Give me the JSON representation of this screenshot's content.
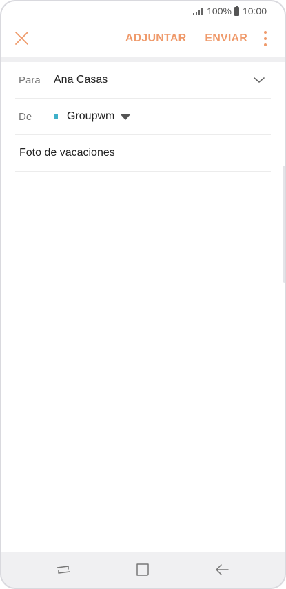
{
  "status_bar": {
    "battery_percent": "100%",
    "time": "10:00"
  },
  "toolbar": {
    "close_icon": "close-icon",
    "attach_label": "ADJUNTAR",
    "send_label": "ENVIAR",
    "more_icon": "more-vertical-icon"
  },
  "compose": {
    "to_label": "Para",
    "to_value": "Ana Casas",
    "from_label": "De",
    "from_value": "Groupwm",
    "subject_value": "Foto de vacaciones",
    "body_value": ""
  },
  "nav_bar": {
    "recent_icon": "recent-apps-icon",
    "home_icon": "home-icon",
    "back_icon": "back-icon"
  },
  "colors": {
    "accent": "#ef9a6b",
    "account_dot": "#3fb0c9"
  }
}
